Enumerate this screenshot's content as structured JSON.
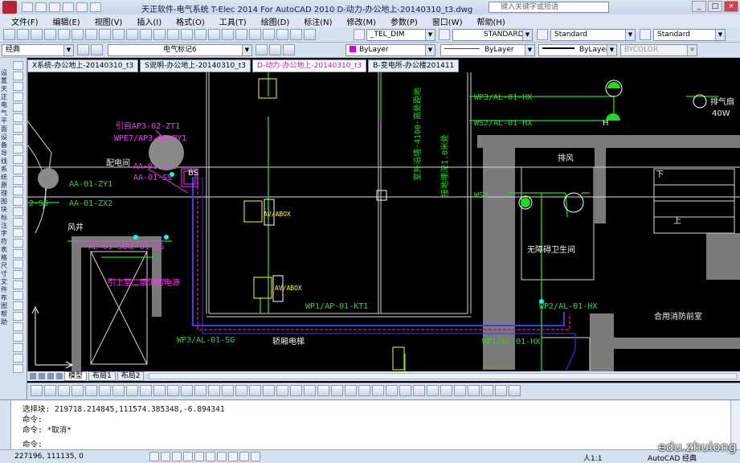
{
  "window": {
    "title": "天正软件-电气系统 T-Elec 2014  For AutoCAD 2010      D-动力-办公地上-20140310_t3.dwg",
    "search_placeholder": "键入关键字或短语"
  },
  "menu": [
    "文件(F)",
    "编辑(E)",
    "视图(V)",
    "插入(I)",
    "格式(O)",
    "工具(T)",
    "绘图(D)",
    "标注(N)",
    "修改(M)",
    "参数(P)",
    "窗口(W)",
    "帮助(H)"
  ],
  "toolbar1": {
    "dimstyle": "_TEL_DIM",
    "textstyle": "STANDARD",
    "tablestyle": "Standard",
    "mleaderstyle": "Standard"
  },
  "toolbar2": {
    "workspace": "经典",
    "layer": "电气标记6",
    "color": "ByLayer",
    "linetype": "ByLayer",
    "lineweight": "ByLayer",
    "plotstyle": "BYCOLOR"
  },
  "doc_tabs": [
    "X系统-办公地上-20140310_t3",
    "S说明-办公地上-20140310_t3",
    "D-动力-办公地上-20140310_t3",
    "B-变电所-办公楼201411"
  ],
  "layout_tabs": [
    "模型",
    "布局1",
    "布局2"
  ],
  "drawing": {
    "labels_magenta": [
      "引自AP3-02-ZT1",
      "WPE7/AP3-02-PY1",
      "AA-01-ZT1",
      "AA-01-SS",
      "AL-01-SG",
      "AE-01-SG",
      "引上至二层消防电源"
    ],
    "labels_green": [
      "AA-01-ZY1",
      "AA-01-ZX2",
      "2-SG",
      "WP3/AL-01-SG",
      "WP1/AP-01-KT1",
      "WP2/AL-01-HX",
      "WP1/AL-01-HX",
      "WP3/AL-01-HX",
      "WS2/AL-01-HX",
      "WS3"
    ],
    "labels_white": [
      "配电间",
      "风井",
      "无障碍卫生间",
      "合用消防前室",
      "轿厢电梯",
      "排风",
      "排气扇",
      "40W",
      "下",
      "上",
      "BS",
      "H"
    ],
    "labels_yellow": [
      "AV/ABOX",
      "AV/ABOX"
    ],
    "labels_vertical": [
      "室外沿墙·4100·高处距地",
      "接地埋深1.0米处"
    ]
  },
  "command": {
    "line1": "选择块: 219718.214845,111574.385348,-6.894341",
    "line2": "命令:",
    "line3": "命令:  *取消*",
    "prompt": "命令:"
  },
  "status": {
    "coords": "227196, 111135, 0",
    "scale": "人1:1",
    "workspace": "AutoCAD 经典"
  },
  "watermark": "edu.zhulong"
}
